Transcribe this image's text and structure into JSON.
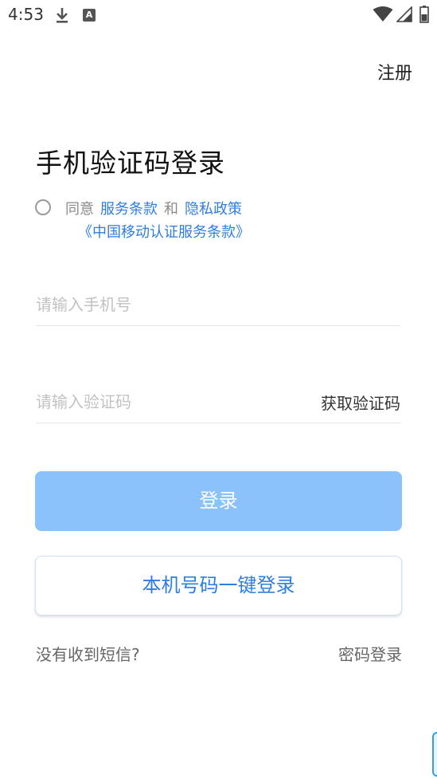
{
  "status_bar": {
    "time": "4:53",
    "icons": [
      "download-icon",
      "a-icon",
      "wifi-icon",
      "signal-icon",
      "battery-icon"
    ],
    "a_glyph": "A"
  },
  "header": {
    "register_label": "注册"
  },
  "main": {
    "title": "手机验证码登录",
    "agreement": {
      "agree_text": "同意",
      "terms_link": "服务条款",
      "and_text": "和",
      "privacy_link": "隐私政策",
      "cmcc_terms_link": "《中国移动认证服务条款》"
    },
    "phone_input": {
      "placeholder": "请输入手机号",
      "value": ""
    },
    "code_input": {
      "placeholder": "请输入验证码",
      "value": ""
    },
    "get_code_label": "获取验证码",
    "login_button_label": "登录",
    "one_key_login_label": "本机号码一键登录",
    "no_sms_label": "没有收到短信?",
    "password_login_label": "密码登录"
  },
  "colors": {
    "accent": "#2e7de0",
    "login_button_disabled": "#8cc2fc",
    "placeholder": "#c2c2c2"
  }
}
